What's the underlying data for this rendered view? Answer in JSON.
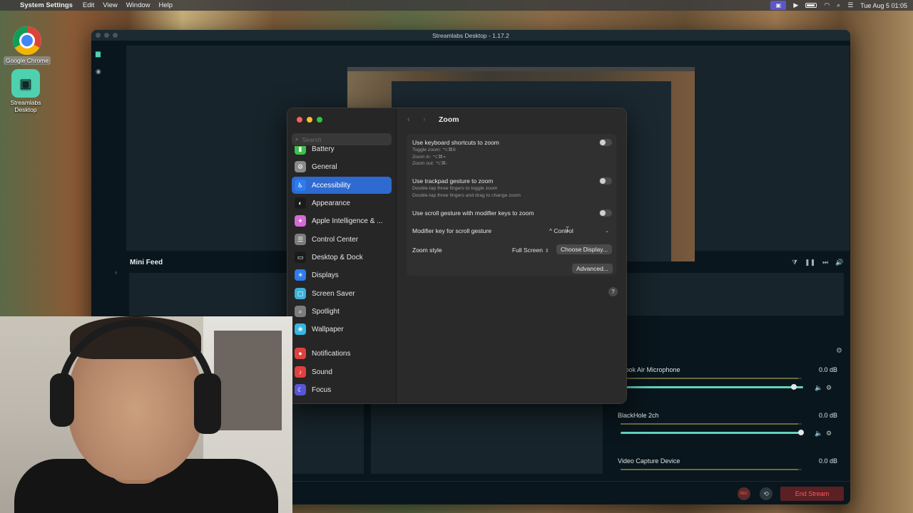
{
  "menubar": {
    "app_name": "System Settings",
    "menus": [
      "Edit",
      "View",
      "Window",
      "Help"
    ],
    "clock": "Tue Aug 5  01:05"
  },
  "desktop": {
    "icons": [
      {
        "label": "Google Chrome"
      },
      {
        "label": "Streamlabs Desktop"
      }
    ]
  },
  "streamlabs": {
    "title": "Streamlabs Desktop - 1.17.2",
    "mini_feed_label": "Mini Feed",
    "mixer": {
      "header": "r",
      "sources": [
        {
          "name": "cBook Air Microphone",
          "db": "0.0 dB",
          "level": 0.95
        },
        {
          "name": "BlackHole 2ch",
          "db": "0.0 dB",
          "level": 0.99
        },
        {
          "name": "Video Capture Device",
          "db": "0.0 dB",
          "level": 0.0
        }
      ]
    },
    "rec_label": "REC",
    "end_stream_label": "End Stream"
  },
  "settings": {
    "search_placeholder": "Search",
    "sidebar": [
      {
        "label": "Battery",
        "color": "#3fbf4f",
        "active": false
      },
      {
        "label": "General",
        "color": "#8a8a8a",
        "active": false
      },
      {
        "label": "Accessibility",
        "color": "#2e7bf0",
        "active": true
      },
      {
        "label": "Appearance",
        "color": "#1b1b1b",
        "active": false
      },
      {
        "label": "Apple Intelligence & ...",
        "color": "#d66ad8",
        "active": false
      },
      {
        "label": "Control Center",
        "color": "#7d7d7d",
        "active": false
      },
      {
        "label": "Desktop & Dock",
        "color": "#1b1b1b",
        "active": false
      },
      {
        "label": "Displays",
        "color": "#2e7bf0",
        "active": false
      },
      {
        "label": "Screen Saver",
        "color": "#3db0d8",
        "active": false
      },
      {
        "label": "Spotlight",
        "color": "#7d7d7d",
        "active": false
      },
      {
        "label": "Wallpaper",
        "color": "#35b6e3",
        "active": false
      },
      {
        "label": "Notifications",
        "color": "#e0413f",
        "active": false
      },
      {
        "label": "Sound",
        "color": "#e0413f",
        "active": false
      },
      {
        "label": "Focus",
        "color": "#5856d6",
        "active": false
      }
    ],
    "page_title": "Zoom",
    "rows": {
      "keyboard": {
        "label": "Use keyboard shortcuts to zoom",
        "sub": [
          "Toggle zoom: ⌥⌘8",
          "Zoom in: ⌥⌘=",
          "Zoom out: ⌥⌘-"
        ]
      },
      "trackpad": {
        "label": "Use trackpad gesture to zoom",
        "sub": [
          "Double-tap three fingers to toggle zoom",
          "Double-tap three fingers and drag to change zoom"
        ]
      },
      "scroll": {
        "label": "Use scroll gesture with modifier keys to zoom"
      },
      "modifier": {
        "label": "Modifier key for scroll gesture",
        "value": "^ Control"
      },
      "zoom_style": {
        "label": "Zoom style",
        "value": "Full Screen",
        "choose_display": "Choose Display..."
      },
      "advanced": "Advanced..."
    },
    "help": "?"
  }
}
